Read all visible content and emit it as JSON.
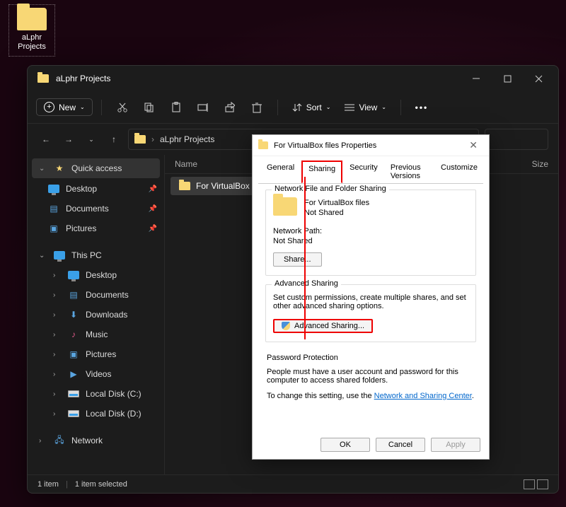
{
  "desktop": {
    "icon_label": "aLphr Projects"
  },
  "window": {
    "title": "aLphr Projects",
    "toolbar": {
      "new": "New",
      "sort": "Sort",
      "view": "View"
    },
    "address": {
      "chevron": "›",
      "path": "aLphr Projects"
    },
    "columns": {
      "name": "Name",
      "size": "Size"
    },
    "files": [
      {
        "name": "For VirtualBox files"
      }
    ],
    "sidebar": {
      "quick": "Quick access",
      "desktop": "Desktop",
      "documents": "Documents",
      "pictures": "Pictures",
      "thispc": "This PC",
      "downloads": "Downloads",
      "music": "Music",
      "videos": "Videos",
      "diskc": "Local Disk (C:)",
      "diskd": "Local Disk (D:)",
      "network": "Network"
    },
    "status": {
      "count": "1 item",
      "selected": "1 item selected"
    }
  },
  "dialog": {
    "title": "For VirtualBox files Properties",
    "tabs": {
      "general": "General",
      "sharing": "Sharing",
      "security": "Security",
      "previous": "Previous Versions",
      "customize": "Customize"
    },
    "nfs": {
      "group": "Network File and Folder Sharing",
      "name": "For VirtualBox files",
      "status": "Not Shared",
      "path_label": "Network Path:",
      "path_value": "Not Shared",
      "share_btn": "Share..."
    },
    "adv": {
      "group": "Advanced Sharing",
      "desc": "Set custom permissions, create multiple shares, and set other advanced sharing options.",
      "btn": "Advanced Sharing..."
    },
    "pw": {
      "group": "Password Protection",
      "desc": "People must have a user account and password for this computer to access shared folders.",
      "change_pre": "To change this setting, use the ",
      "link": "Network and Sharing Center",
      "dot": "."
    },
    "buttons": {
      "ok": "OK",
      "cancel": "Cancel",
      "apply": "Apply"
    }
  }
}
